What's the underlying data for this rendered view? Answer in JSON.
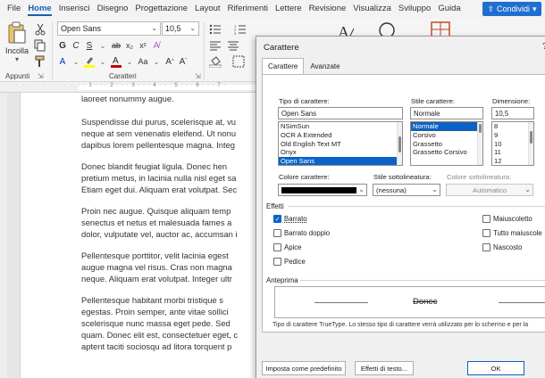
{
  "menubar": {
    "items": [
      "File",
      "Home",
      "Inserisci",
      "Disegno",
      "Progettazione",
      "Layout",
      "Riferimenti",
      "Lettere",
      "Revisione",
      "Visualizza",
      "Sviluppo",
      "Guida"
    ],
    "active": "Home",
    "share_label": "Condividi"
  },
  "ribbon": {
    "paste_label": "Incolla",
    "clipboard_label": "Appunti",
    "font_group_label": "Caratteri",
    "font_name": "Open Sans",
    "font_size": "10,5",
    "format_row_1": [
      "G",
      "C",
      "S",
      "ab",
      "x₂",
      "x²"
    ],
    "format_row_2": [
      "A",
      "Aa",
      "A",
      "A"
    ]
  },
  "ruler": {
    "marks": "· · 1 · · · 2 · · · 3 · · · 4 · · · 5 · · · 6 · · · 7 ·"
  },
  "document": {
    "paragraphs": [
      "laoreet nonummy augue.",
      "Suspendisse dui purus, scelerisque at, vu\nneque at sem venenatis eleifend. Ut nonu\ndapibus lorem pellentesque magna. Integ",
      "Donec blandit feugiat ligula. Donec hen\npretium metus, in lacinia nulla nisl eget sa\nEtiam eget dui. Aliquam erat volutpat. Sec",
      "Proin nec augue. Quisque aliquam temp\nsenectus et netus et malesuada fames a\ndolor, vulputate vel, auctor ac, accumsan i",
      "Pellentesque porttitor, velit lacinia egest\naugue magna vel risus. Cras non magna\nneque. Aliquam erat volutpat. Integer ultr",
      "Pellentesque habitant morbi tristique s\negestas. Proin semper, ante vitae sollici\nscelerisque nunc massa eget pede. Sed\nquam. Donec elit est, consectetuer eget, c\naptent taciti sociosqu ad litora torquent p"
    ]
  },
  "dialog": {
    "title": "Carattere",
    "help": "?",
    "tabs": [
      "Carattere",
      "Avanzate"
    ],
    "font_label": "Tipo di carattere:",
    "font_value": "Open Sans",
    "font_list": [
      "NSimSun",
      "OCR A Extended",
      "Old English Text MT",
      "Onyx",
      "Open Sans"
    ],
    "font_list_selected": "Open Sans",
    "style_label": "Stile carattere:",
    "style_value": "Normale",
    "style_list": [
      "Normale",
      "Corsivo",
      "Grassetto",
      "Grassetto Corsivo"
    ],
    "style_list_selected": "Normale",
    "size_label": "Dimensione:",
    "size_value": "10,5",
    "size_list": [
      "8",
      "9",
      "10",
      "11",
      "12"
    ],
    "font_color_label": "Colore carattere:",
    "font_color": "#000000",
    "underline_style_label": "Stile sottolineatura:",
    "underline_style_value": "(nessuna)",
    "underline_color_label": "Colore sottolineatura:",
    "underline_color_value": "Automatico",
    "effects_label": "Effetti",
    "effects_left": [
      {
        "label": "Barrato",
        "checked": true
      },
      {
        "label": "Barrato doppio",
        "checked": false
      },
      {
        "label": "Apice",
        "checked": false
      },
      {
        "label": "Pedice",
        "checked": false
      }
    ],
    "effects_right": [
      {
        "label": "Maiuscoletto",
        "checked": false
      },
      {
        "label": "Tutto maiuscole",
        "checked": false
      },
      {
        "label": "Nascosto",
        "checked": false
      }
    ],
    "preview_label": "Anteprima",
    "preview_text": "Donec",
    "preview_note": "Tipo di carattere TrueType. Lo stesso tipo di carattere verrà utilizzato per lo schermo e per la",
    "btn_default": "Imposta come predefinito",
    "btn_effects": "Effetti di testo...",
    "btn_ok": "OK"
  },
  "colors": {
    "accent": "#1a5db5",
    "selection": "#0a63c8",
    "font_red": "#c00000",
    "highlight_yellow": "#ffff00"
  }
}
